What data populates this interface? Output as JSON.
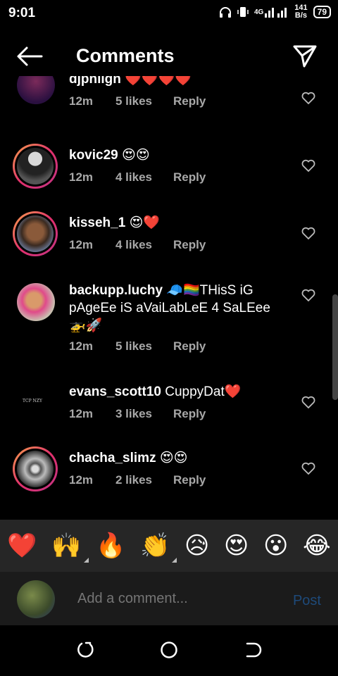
{
  "status": {
    "time": "9:01",
    "network_speed_value": "141",
    "network_speed_unit": "B/s",
    "signal_label": "4G",
    "battery": "79"
  },
  "header": {
    "title": "Comments"
  },
  "comments": [
    {
      "username": "djphiign",
      "text": "❤️❤️❤️❤️",
      "time": "12m",
      "likes": "5 likes",
      "reply": "Reply"
    },
    {
      "username": "kovic29",
      "text": "😍😍",
      "time": "12m",
      "likes": "4 likes",
      "reply": "Reply"
    },
    {
      "username": "kisseh_1",
      "text": "😍❤️",
      "time": "12m",
      "likes": "4 likes",
      "reply": "Reply"
    },
    {
      "username": "backupp.luchy",
      "text": "🧢🏳️‍🌈THisS iG pAgeEe iS aVaiLabLeE 4 SaLEee 🚁🚀",
      "time": "12m",
      "likes": "5 likes",
      "reply": "Reply"
    },
    {
      "username": "evans_scott10",
      "text": "CuppyDat❤️",
      "time": "12m",
      "likes": "3 likes",
      "reply": "Reply",
      "avatar_text": "TCP NZY"
    },
    {
      "username": "chacha_slimz",
      "text": "😍😍",
      "time": "12m",
      "likes": "2 likes",
      "reply": "Reply"
    }
  ],
  "emoji_bar": [
    "❤️",
    "🙌",
    "🔥",
    "👏",
    "😥",
    "😍",
    "😮",
    "😂"
  ],
  "composer": {
    "placeholder": "Add a comment...",
    "post_label": "Post"
  },
  "colors": {
    "background": "#000000",
    "meta_text": "#a8a8a8",
    "emoji_bar": "#262626",
    "post_disabled": "#1e4a7a"
  }
}
